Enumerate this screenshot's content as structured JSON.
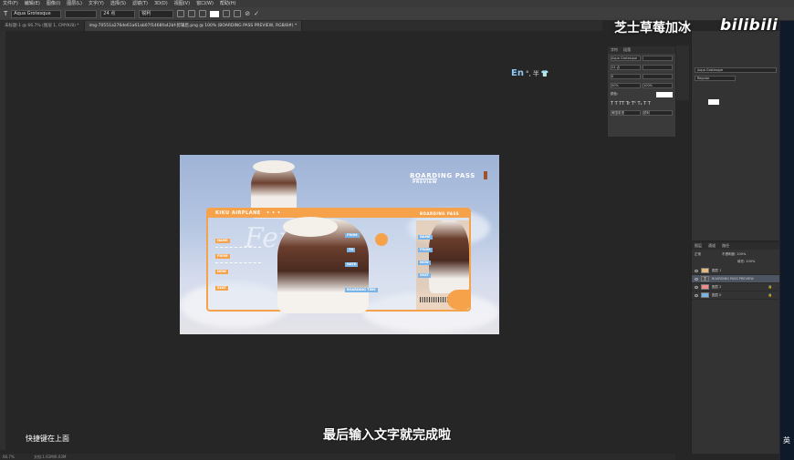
{
  "menu": [
    "文件(F)",
    "编辑(E)",
    "图像(I)",
    "图层(L)",
    "文字(Y)",
    "选择(S)",
    "滤镜(T)",
    "3D(D)",
    "视图(V)",
    "窗口(W)",
    "帮助(H)"
  ],
  "options": {
    "font_family": "Aqua Grotesque",
    "font_size": "24 点",
    "antialias": "锐利"
  },
  "tabs": [
    {
      "label": "未标题-1 @ 66.7% (图层 1, CMYK/8) *"
    },
    {
      "label": "img-70551a276de61a61ab07f1468fa42bf-剪辑后.png @ 100% (BOARDING PASS PREVIEW, RGB/8#) *"
    }
  ],
  "status": {
    "zoom": "66.7%",
    "doc": "文档:1.61M/6.03M"
  },
  "design": {
    "title": "BOARDING PASS",
    "subtitle": "PREVIEW",
    "airline": "KIKU AIRPLANE",
    "airline_dots": "• • •",
    "right_header": "BOARDING PASS",
    "labels_left": [
      "NAME",
      "FROM",
      "NOW",
      "SEAT"
    ],
    "labels_mid": [
      "FROM",
      "TO",
      "GATE"
    ],
    "labels_right": [
      "NAME",
      "FROM",
      "NOW",
      "SEAT"
    ],
    "boarding_time": "BOARDING TIME",
    "big_text": "Ferry"
  },
  "ime": {
    "en": "En",
    "punct": "°,",
    "width": "半",
    "icon": "shirt-icon"
  },
  "char_panel": {
    "tabs": [
      "字符",
      "段落"
    ],
    "font": "Aqua Grotesque",
    "size": "24 点",
    "leading": "0",
    "tracking": "50%",
    "scale": "100%",
    "color_label": "颜色:",
    "lang": "美国英语",
    "aa": "锐利"
  },
  "right_panel": {
    "font": "Aqua Grotesque",
    "style": "Regular"
  },
  "layers_panel": {
    "tabs": [
      "图层",
      "通道",
      "路径"
    ],
    "mode": "正常",
    "opacity": "不透明度: 100%",
    "fill": "填充: 100%",
    "items": [
      {
        "name": "图层 1"
      },
      {
        "name": "BOARDING PASS PREVIEW"
      },
      {
        "name": "图层 2"
      },
      {
        "name": "图层 0"
      }
    ]
  },
  "overlay": {
    "watermark": "芝士草莓加冰",
    "logo": "bilibili",
    "subtitle": "最后输入文字就完成啦",
    "hint": "快捷键在上面"
  },
  "dock_label": "英",
  "colors": {
    "accent": "#f6a24a",
    "blue": "#7ab3e6",
    "bg": "#262626"
  }
}
